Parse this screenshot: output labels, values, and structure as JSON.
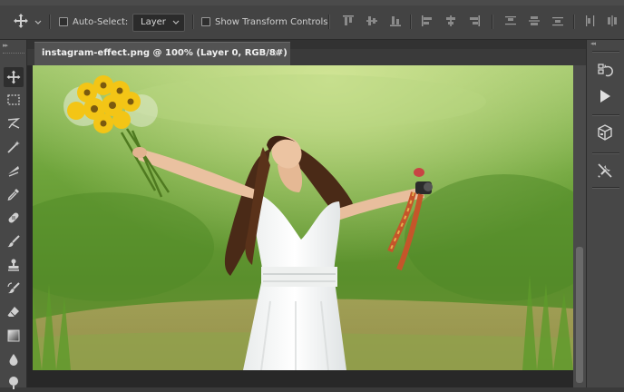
{
  "options_bar": {
    "auto_select_label": "Auto-Select:",
    "layer_select_value": "Layer",
    "show_transform_label": "Show Transform Controls"
  },
  "document": {
    "tab_title": "instagram-effect.png @ 100% (Layer 0, RGB/8#)",
    "close_glyph": "×"
  },
  "colors": {
    "app_bg": "#3a3a3a",
    "panel_bg": "#474747",
    "tab_active": "#535353",
    "icon": "#c8c8c8"
  },
  "left_tools": [
    {
      "name": "move-tool",
      "icon": "move-icon"
    },
    {
      "name": "marquee-tool",
      "icon": "rect-marquee-icon"
    },
    {
      "name": "lasso-tool",
      "icon": "lasso-icon"
    },
    {
      "name": "quick-select-tool",
      "icon": "magic-wand-icon"
    },
    {
      "name": "crop-tool",
      "icon": "crop-icon"
    },
    {
      "name": "eyedropper-tool",
      "icon": "eyedropper-icon"
    },
    {
      "name": "healing-tool",
      "icon": "bandage-icon"
    },
    {
      "name": "brush-tool",
      "icon": "brush-icon"
    },
    {
      "name": "stamp-tool",
      "icon": "stamp-icon"
    },
    {
      "name": "history-brush-tool",
      "icon": "history-brush-icon"
    },
    {
      "name": "eraser-tool",
      "icon": "eraser-icon"
    },
    {
      "name": "gradient-tool",
      "icon": "gradient-icon"
    },
    {
      "name": "blur-tool",
      "icon": "drop-icon"
    },
    {
      "name": "dodge-tool",
      "icon": "dodge-icon"
    }
  ],
  "right_dock": [
    {
      "name": "history-panel-button",
      "icon": "history-icon"
    },
    {
      "name": "actions-panel-button",
      "icon": "play-icon"
    },
    {
      "name": "3d-panel-button",
      "icon": "cube-icon"
    },
    {
      "name": "tools-panel-button",
      "icon": "tools-icon"
    }
  ]
}
